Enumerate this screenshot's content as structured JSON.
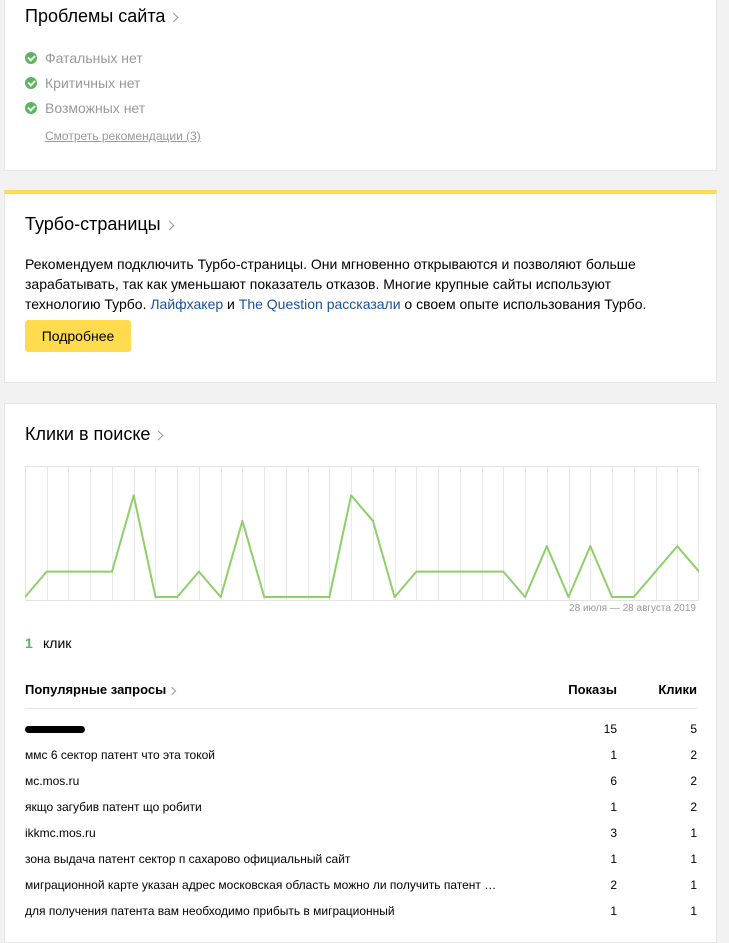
{
  "problems": {
    "title": "Проблемы сайта",
    "items": [
      "Фатальных нет",
      "Критичных нет",
      "Возможных нет"
    ],
    "recommendations_link": "Смотреть рекомендации (3)"
  },
  "turbo": {
    "title": "Турбо-страницы",
    "text_1": "Рекомендуем подключить Турбо-страницы. Они мгновенно открываются и позволяют больше зарабатывать, так как уменьшают показатель отказов. Многие крупные сайты используют технологию Турбо. ",
    "link_1": "Лайфхакер",
    "text_2": " и ",
    "link_2": "The Question рассказали",
    "text_3": " о своем опыте использования Турбо.",
    "button": "Подробнее"
  },
  "clicks": {
    "title": "Клики в поиске",
    "date_range": "28 июля — 28 августа 2019",
    "total_value": "1",
    "total_label": "клик",
    "table": {
      "header_query": "Популярные запросы",
      "header_shows": "Показы",
      "header_clicks": "Клики",
      "rows": [
        {
          "query": "",
          "redacted": true,
          "shows": "15",
          "clicks": "5"
        },
        {
          "query": "ммс 6 сектор патент что эта токой",
          "shows": "1",
          "clicks": "2"
        },
        {
          "query": "мс.mos.ru",
          "shows": "6",
          "clicks": "2"
        },
        {
          "query": "якщо загубив патент що робити",
          "shows": "1",
          "clicks": "2"
        },
        {
          "query": "ikkmc.mos.ru",
          "shows": "3",
          "clicks": "1"
        },
        {
          "query": "зона выдача патент сектор п сахарово официальный сайт",
          "shows": "1",
          "clicks": "1"
        },
        {
          "query": "миграционной карте указан адрес московская область можно ли получить патент …",
          "shows": "2",
          "clicks": "1"
        },
        {
          "query": "для получения патента вам необходимо прибыть в миграционный",
          "shows": "1",
          "clicks": "1"
        }
      ]
    }
  },
  "chart_data": {
    "type": "line",
    "title": "",
    "xlabel": "",
    "ylabel": "",
    "x": [
      "28.07",
      "29.07",
      "30.07",
      "31.07",
      "01.08",
      "02.08",
      "03.08",
      "04.08",
      "05.08",
      "06.08",
      "07.08",
      "08.08",
      "09.08",
      "10.08",
      "11.08",
      "12.08",
      "13.08",
      "14.08",
      "15.08",
      "16.08",
      "17.08",
      "18.08",
      "19.08",
      "20.08",
      "21.08",
      "22.08",
      "23.08",
      "24.08",
      "25.08",
      "26.08",
      "27.08",
      "28.08"
    ],
    "series": [
      {
        "values": [
          0,
          1,
          1,
          1,
          1,
          4,
          0,
          0,
          1,
          0,
          3,
          0,
          0,
          0,
          0,
          4,
          3,
          0,
          1,
          1,
          1,
          1,
          1,
          0,
          2,
          0,
          2,
          0,
          0,
          1,
          2,
          1
        ]
      }
    ],
    "ylim": [
      0,
      5
    ],
    "grid": true,
    "color": "#8fcf6a"
  }
}
